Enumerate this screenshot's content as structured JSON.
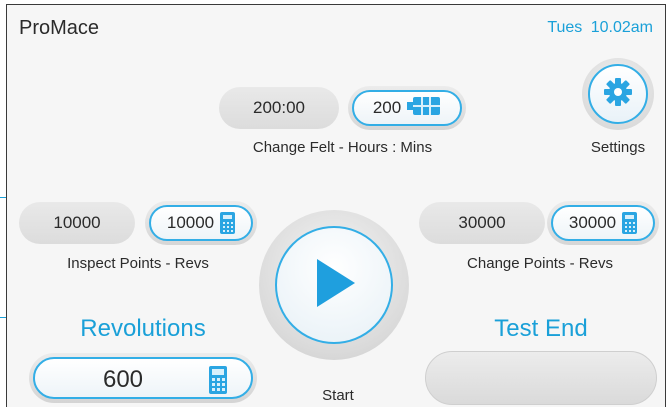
{
  "header": {
    "app_title": "ProMace",
    "clock": "Tues 10.02am"
  },
  "change_felt": {
    "current": "200:00",
    "setpoint": "200",
    "label": "Change Felt - Hours : Mins"
  },
  "settings": {
    "label": "Settings",
    "icon": "gear-icon"
  },
  "inspect_points": {
    "current": "10000",
    "setpoint": "10000",
    "label": "Inspect Points - Revs"
  },
  "change_points": {
    "current": "30000",
    "setpoint": "30000",
    "label": "Change Points - Revs"
  },
  "start": {
    "label": "Start",
    "icon": "play-icon"
  },
  "revolutions": {
    "label": "Revolutions",
    "value": "600"
  },
  "test_end": {
    "label": "Test End",
    "value": ""
  },
  "colors": {
    "accent": "#1aa0d8",
    "outline": "#33aee6",
    "background": "#f6f6f6"
  }
}
